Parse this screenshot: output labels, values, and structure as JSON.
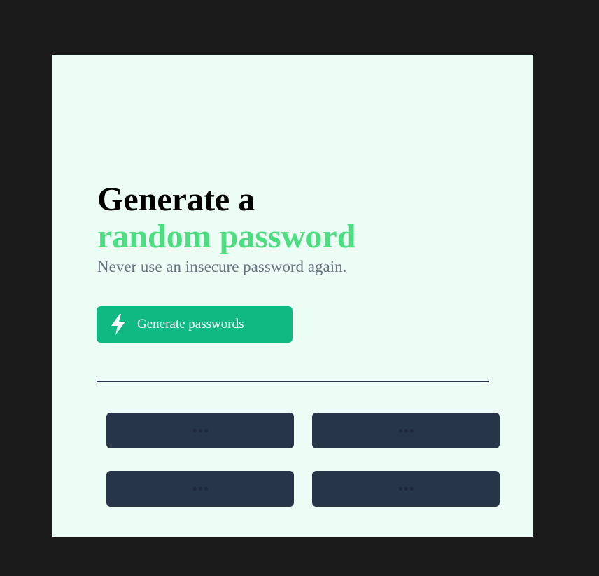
{
  "hero": {
    "title_line1": "Generate a",
    "title_line2": "random password",
    "subtitle": "Never use an insecure password again."
  },
  "generate_button": {
    "label": "Generate passwords",
    "icon": "lightning-bolt-icon"
  },
  "password_slots": [
    {
      "icon": "ellipsis-icon"
    },
    {
      "icon": "ellipsis-icon"
    },
    {
      "icon": "ellipsis-icon"
    },
    {
      "icon": "ellipsis-icon"
    }
  ],
  "colors": {
    "page_background": "#1b1b1b",
    "card_background": "#ecfdf5",
    "title_black": "#000000",
    "accent_green": "#4ade80",
    "subtitle_gray": "#6b7280",
    "button_green": "#10b981",
    "slot_background": "#273549",
    "dots": "#1e293b"
  }
}
